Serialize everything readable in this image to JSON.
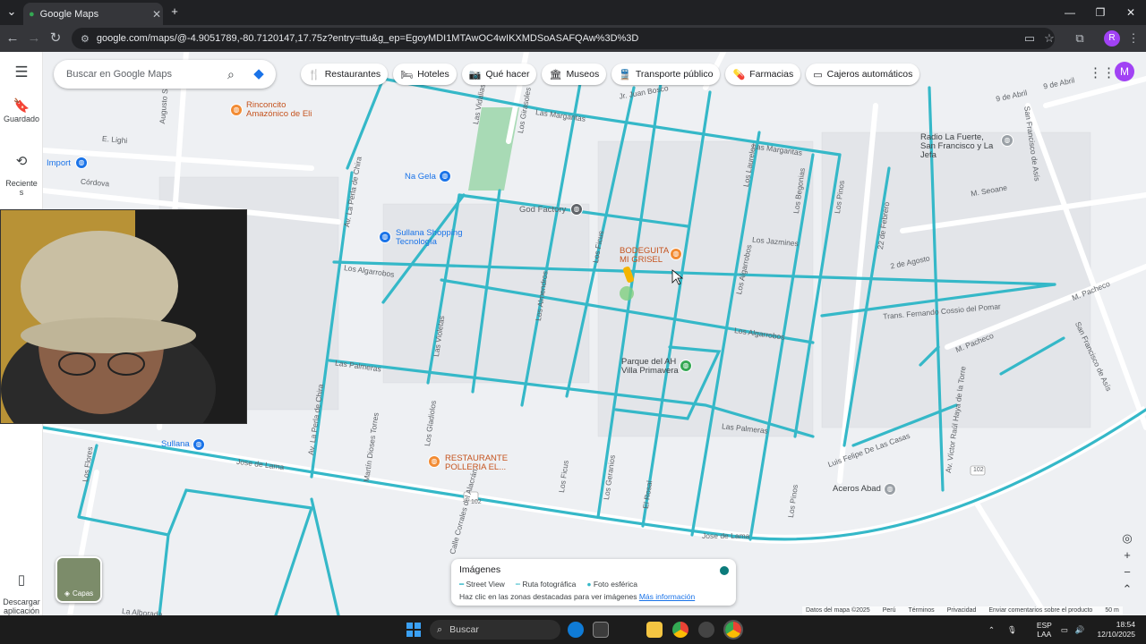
{
  "browser": {
    "tab_title": "Google Maps",
    "url": "google.com/maps/@-4.9051789,-80.7120147,17.75z?entry=ttu&g_ep=EgoyMDI1MTAwOC4wIKXMDSoASAFQAw%3D%3D",
    "profile_initial": "R"
  },
  "sidebar": {
    "saved": "Guardado",
    "recent": "Reciente\ns",
    "download": "Descargar\naplicación"
  },
  "search": {
    "placeholder": "Buscar en Google Maps"
  },
  "chips": [
    {
      "icon": "restaurant-icon",
      "label": "Restaurantes"
    },
    {
      "icon": "hotel-icon",
      "label": "Hoteles"
    },
    {
      "icon": "camera-icon",
      "label": "Qué hacer"
    },
    {
      "icon": "museum-icon",
      "label": "Museos"
    },
    {
      "icon": "transit-icon",
      "label": "Transporte público"
    },
    {
      "icon": "pharmacy-icon",
      "label": "Farmacias"
    },
    {
      "icon": "atm-icon",
      "label": "Cajeros automáticos"
    }
  ],
  "account_initial": "M",
  "streets": [
    "Jr. Juan Bosco",
    "9 de Abril",
    "9 de Abril",
    "Augusto Salaverry",
    "E. Lighi",
    "Córdova",
    "Av. La Perla de Chira",
    "Las Vidalias",
    "Los Girasoles",
    "Las Margaritas",
    "Las Margaritas",
    "Los Laureles",
    "Los Ficus",
    "Los Begonias",
    "Los Pinos",
    "Los Jazmines",
    "Los Algarrobos",
    "Los Algarrobos",
    "Los Almendros",
    "Los Algarrobos",
    "22 de Febrero",
    "2 de Agosto",
    "M. Seoane",
    "M. Pacheco",
    "M. Pacheco",
    "Trans. Fernando Cossio del Pomar",
    "Las Palmeras",
    "Las Palmeras",
    "Av. La Perla de Chira",
    "Martín Dioses Torres",
    "Los Geranios",
    "Jose de Lama",
    "Jose de Lama",
    "Los Flores",
    "Los Ficus",
    "El Rosal",
    "Los Pinos",
    "Calle Corrales del Alacrán",
    "Luis Felipe De Las Casas",
    "Av. Víctor Raúl Haya de la Torre",
    "San Francisco de Asís",
    "San Francisco de Asís",
    "Las Violetas",
    "Los Gladiolos",
    "La Alborada"
  ],
  "places": [
    {
      "name": "Rinconcito Amazónico de Eli",
      "color": "#c5531e"
    },
    {
      "name": "Import",
      "color": "#1a73e8"
    },
    {
      "name": "Na Gela",
      "color": "#1a73e8"
    },
    {
      "name": "God Factory",
      "color": "#5f6368"
    },
    {
      "name": "Sullana Shopping Tecnología",
      "color": "#1a73e8"
    },
    {
      "name": "BODEGUITA MI GRISEL",
      "color": "#c5531e"
    },
    {
      "name": "Parque del AH Villa Primavera",
      "color": "#3c4043"
    },
    {
      "name": "Radio La Fuerte, San Francisco y La Jefa",
      "color": "#3c4043"
    },
    {
      "name": "Sullana",
      "color": "#1a73e8"
    },
    {
      "name": "RESTAURANTE POLLERIA EL...",
      "color": "#c5531e"
    },
    {
      "name": "Aceros Abad",
      "color": "#3c4043"
    }
  ],
  "route_badges": [
    "102",
    "102"
  ],
  "layers_label": "Capas",
  "street_view_panel": {
    "title": "Imágenes",
    "legend": [
      "Street View",
      "Ruta fotográfica",
      "Foto esférica"
    ],
    "hint": "Haz clic en las zonas destacadas para ver imágenes",
    "link": "Más información"
  },
  "map_footer": [
    "Datos del mapa ©2025",
    "Perú",
    "Términos",
    "Privacidad",
    "Enviar comentarios sobre el producto",
    "50 m"
  ],
  "taskbar": {
    "search": "Buscar",
    "lang": "ESP\nLAA",
    "time": "18:54",
    "date": "12/10/2025"
  },
  "colors": {
    "street_view_line": "#35b8c8",
    "accent": "#1a73e8",
    "restaurant_pin": "#f28b33"
  }
}
